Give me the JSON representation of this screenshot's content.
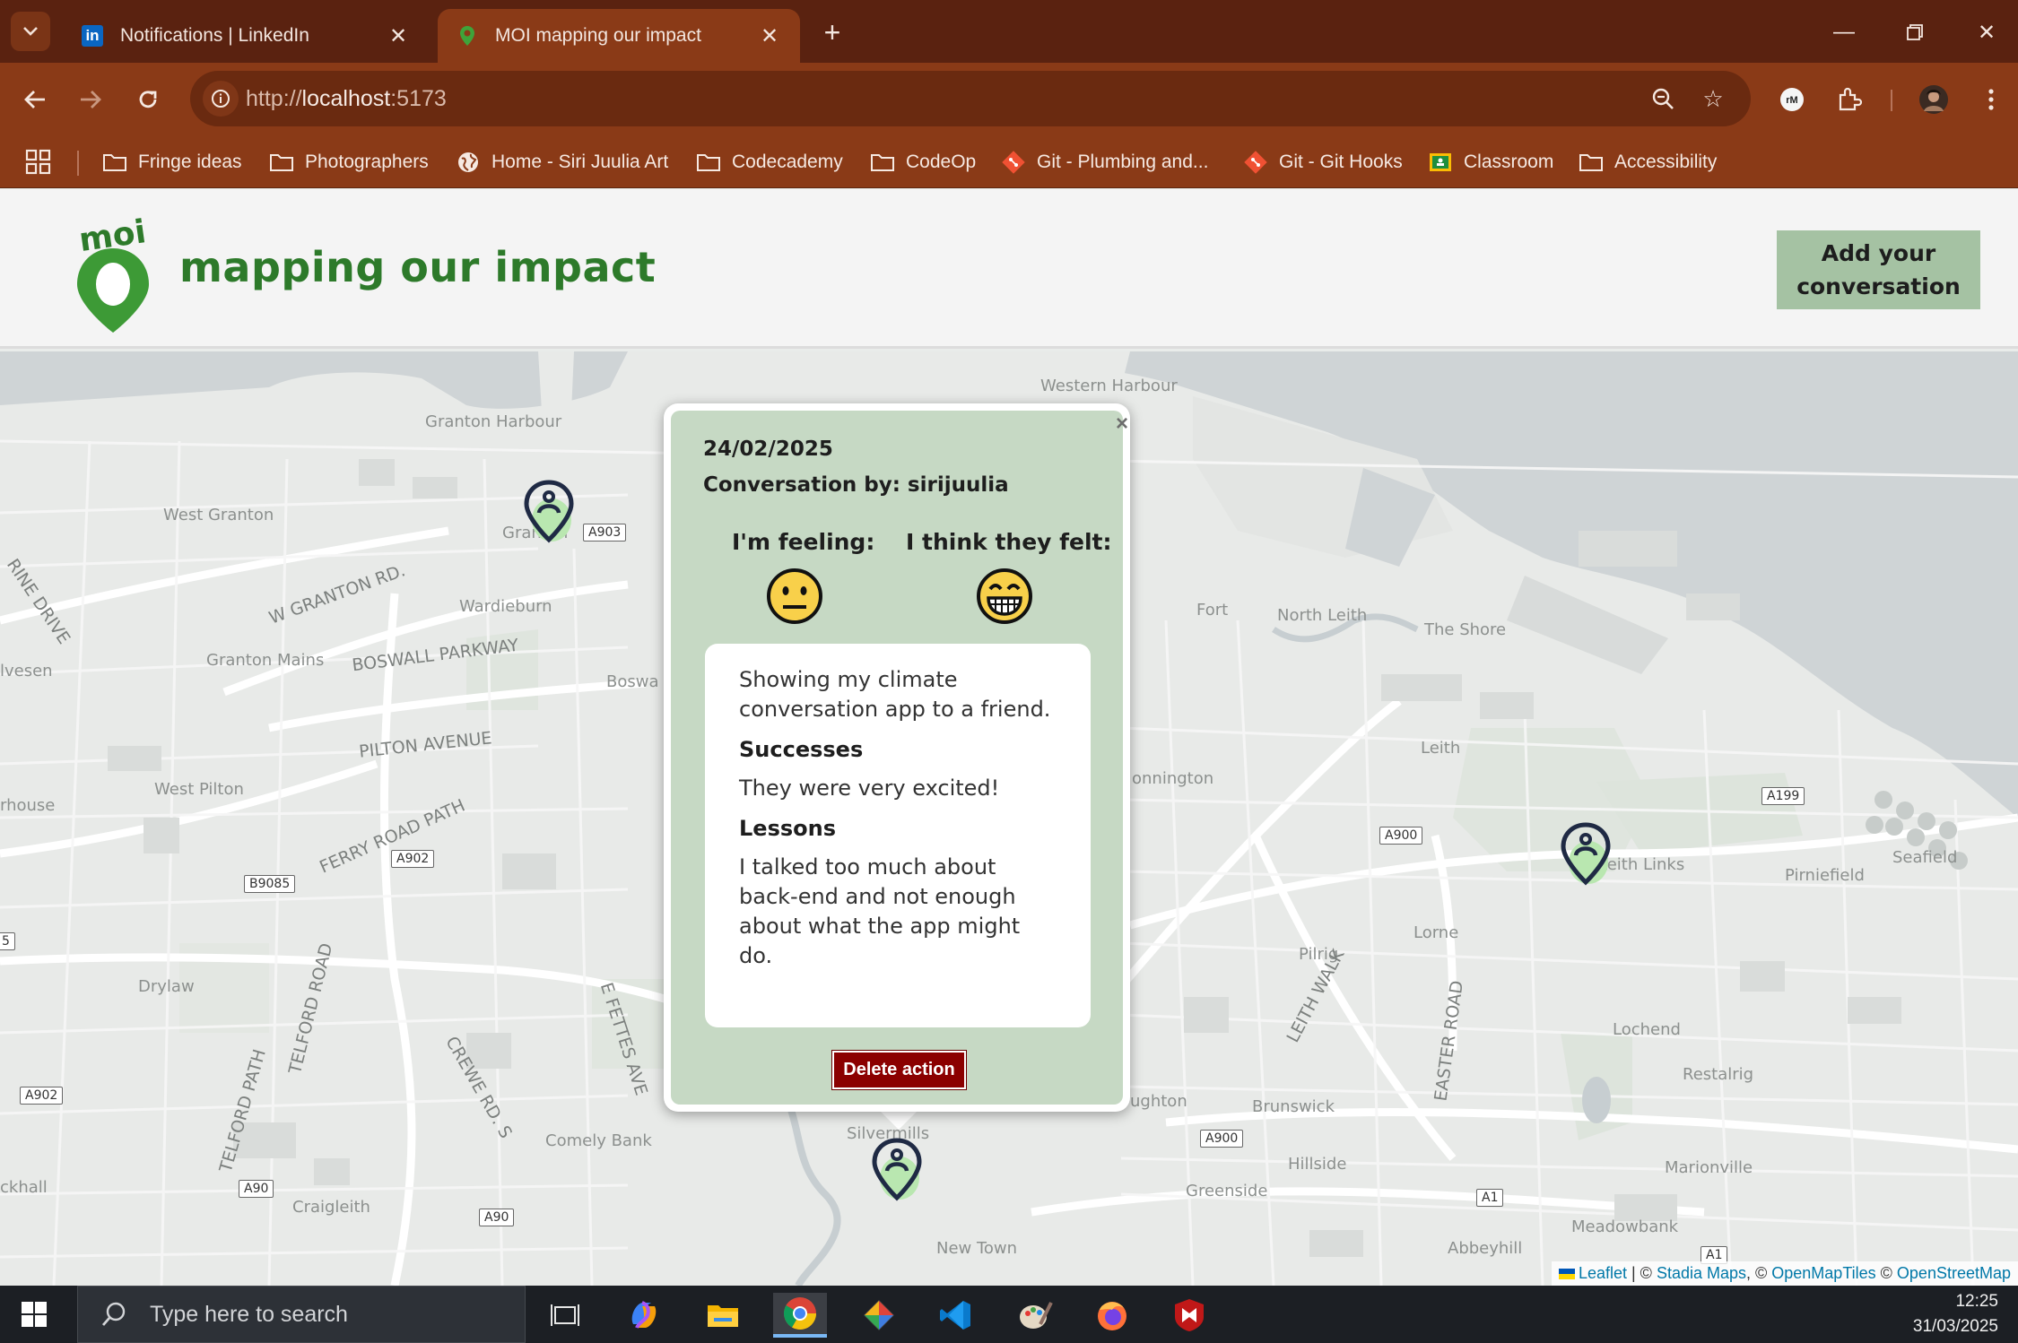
{
  "browser": {
    "tabs": [
      {
        "title": "Notifications | LinkedIn",
        "favicon": "linkedin-icon",
        "active": false
      },
      {
        "title": "MOI mapping our impact",
        "favicon": "map-pin-icon",
        "active": true
      }
    ],
    "url_scheme": "http://",
    "url_host": "localhost",
    "url_rest": ":5173",
    "bookmarks": [
      {
        "label": "Fringe ideas",
        "icon": "folder-icon"
      },
      {
        "label": "Photographers",
        "icon": "folder-icon"
      },
      {
        "label": "Home - Siri Juulia Art",
        "icon": "globe-icon"
      },
      {
        "label": "Codecademy",
        "icon": "folder-icon"
      },
      {
        "label": "CodeOp",
        "icon": "folder-icon"
      },
      {
        "label": "Git - Plumbing and...",
        "icon": "git-icon"
      },
      {
        "label": "Git - Git Hooks",
        "icon": "git-icon"
      },
      {
        "label": "Classroom",
        "icon": "classroom-icon"
      },
      {
        "label": "Accessibility",
        "icon": "folder-icon"
      }
    ],
    "theme_color": "#8a3a17"
  },
  "app": {
    "logo_text": "moi",
    "brand_name": "mapping our impact",
    "add_button": "Add your conversation",
    "brand_color": "#2d7a2a"
  },
  "map": {
    "place_labels": [
      "Western Harbour",
      "Granton Harbour",
      "West Granton",
      "Granton",
      "Wardieburn",
      "Granton Mains",
      "Boswa",
      "West Pilton",
      "rhouse",
      "Drylaw",
      "lvesen",
      "Fort",
      "North Leith",
      "The Shore",
      "Leith",
      "onnington",
      "Leith Links",
      "Pirniefield",
      "Seafield",
      "Lorne",
      "Pilrig",
      "Lochend",
      "Restalrig",
      "Brunswick",
      "ughton",
      "Hillside",
      "Marionville",
      "Greenside",
      "Meadowbank",
      "Abbeyhill",
      "New Town",
      "Comely Bank",
      "Craigleith",
      "ckhall",
      "Silvermills"
    ],
    "road_labels": [
      "W GRANTON RD.",
      "BOSWALL PARKWAY",
      "PILTON AVENUE",
      "FERRY ROAD PATH",
      "TELFORD ROAD",
      "TELFORD PATH",
      "CREWE RD. S",
      "E FETTES AVE",
      "LEITH WALK",
      "EASTER ROAD",
      "RINE DRIVE"
    ],
    "road_badges": [
      "A903",
      "A902",
      "B9085",
      "A902",
      "A90",
      "A90",
      "A900",
      "A900",
      "A199",
      "A1",
      "A1",
      "5"
    ],
    "attribution": {
      "leaflet": "Leaflet",
      "sep1": " | © ",
      "stadia": "Stadia Maps",
      "sep2": ", © ",
      "omt": "OpenMapTiles",
      "sep3": " © ",
      "osm": "OpenStreetMap"
    }
  },
  "popup": {
    "date": "24/02/2025",
    "by": "Conversation by: sirijuulia",
    "feeling_label": "I'm feeling:",
    "feeling_emoji": "neutral-face",
    "they_felt_label": "I think they felt:",
    "they_felt_emoji": "grinning-face",
    "description": "Showing my climate conversation app to a friend.",
    "successes_heading": "Successes",
    "successes": "They were very excited!",
    "lessons_heading": "Lessons",
    "lessons": "I talked too much about back-end and not enough about what the app might do.",
    "delete_button": "Delete action",
    "close": "×"
  },
  "taskbar": {
    "search_placeholder": "Type here to search",
    "time": "12:25",
    "date": "31/03/2025",
    "apps": [
      "task-view-icon",
      "copilot-icon",
      "file-explorer-icon",
      "chrome-icon",
      "git-client-icon",
      "vscode-icon",
      "paint-icon",
      "firefox-icon",
      "mcafee-icon"
    ]
  }
}
